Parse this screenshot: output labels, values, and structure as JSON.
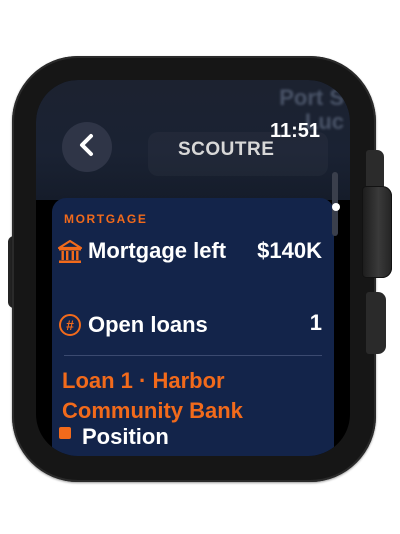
{
  "status": {
    "time": "11:51"
  },
  "header": {
    "app_name": "SCOUTRE",
    "back_icon": "chevron-left-icon",
    "map_hint": "Port S\nLuc"
  },
  "mortgage": {
    "section_label": "MORTGAGE",
    "rows": [
      {
        "icon": "bank-icon",
        "label": "Mortgage left",
        "value": "$140K"
      },
      {
        "icon": "number-sign-icon",
        "label": "Open loans",
        "value": "1"
      }
    ]
  },
  "loan": {
    "title": "Loan 1 · Harbor Community Bank",
    "next_label": "Position"
  },
  "colors": {
    "accent": "#f26a1b",
    "card": "#13244a"
  }
}
